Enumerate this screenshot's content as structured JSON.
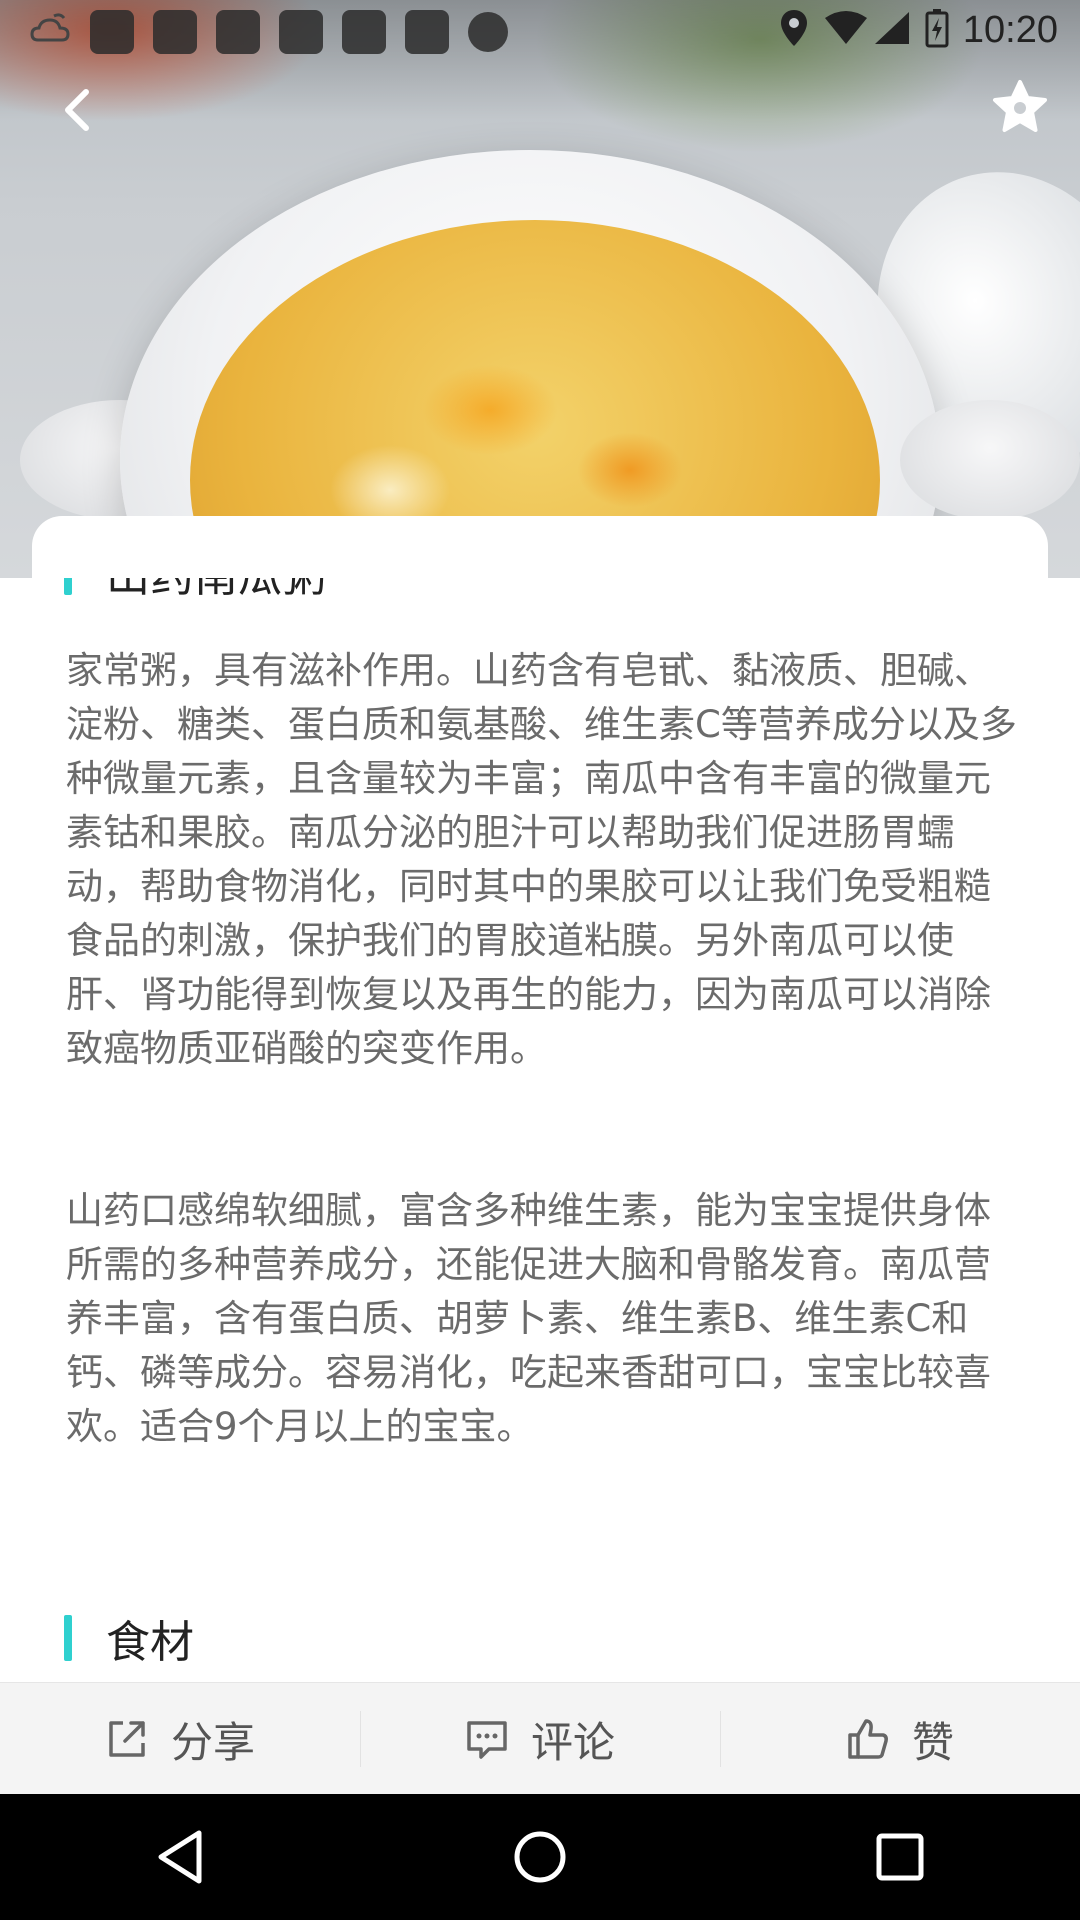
{
  "status_bar": {
    "time": "10:20",
    "left_icons": [
      "weather-icon",
      "notification-icon",
      "notification-icon",
      "notification-icon",
      "notification-icon",
      "notification-icon",
      "notification-icon",
      "notification-dot-icon"
    ],
    "right_icons": [
      "location-icon",
      "wifi-icon",
      "signal-icon",
      "battery-charging-icon"
    ]
  },
  "header": {
    "back_icon": "chevron-left-icon",
    "favorite_icon": "star-icon"
  },
  "recipe": {
    "title": "山药南瓜粥",
    "paragraphs": [
      "家常粥，具有滋补作用。山药含有皂甙、黏液质、胆碱、淀粉、糖类、蛋白质和氨基酸、维生素C等营养成分以及多种微量元素，且含量较为丰富；南瓜中含有丰富的微量元素钴和果胶。南瓜分泌的胆汁可以帮助我们促进肠胃蠕动，帮助食物消化，同时其中的果胶可以让我们免受粗糙食品的刺激，保护我们的胃胶道粘膜。另外南瓜可以使肝、肾功能得到恢复以及再生的能力，因为南瓜可以消除致癌物质亚硝酸的突变作用。",
      "山药口感绵软细腻，富含多种维生素，能为宝宝提供身体所需的多种营养成分，还能促进大脑和骨骼发育。南瓜营养丰富，含有蛋白质、胡萝卜素、维生素B、维生素C和钙、磷等成分。容易消化，吃起来香甜可口，宝宝比较喜欢。适合9个月以上的宝宝。"
    ],
    "ingredients_title": "食材"
  },
  "actions": {
    "share": "分享",
    "comment": "评论",
    "like": "赞"
  },
  "colors": {
    "accent": "#2fd0cf",
    "body_text": "#6b6b6b",
    "title_text": "#222222",
    "action_bar_bg": "#f4f4f4",
    "nav_bar_bg": "#000000"
  }
}
